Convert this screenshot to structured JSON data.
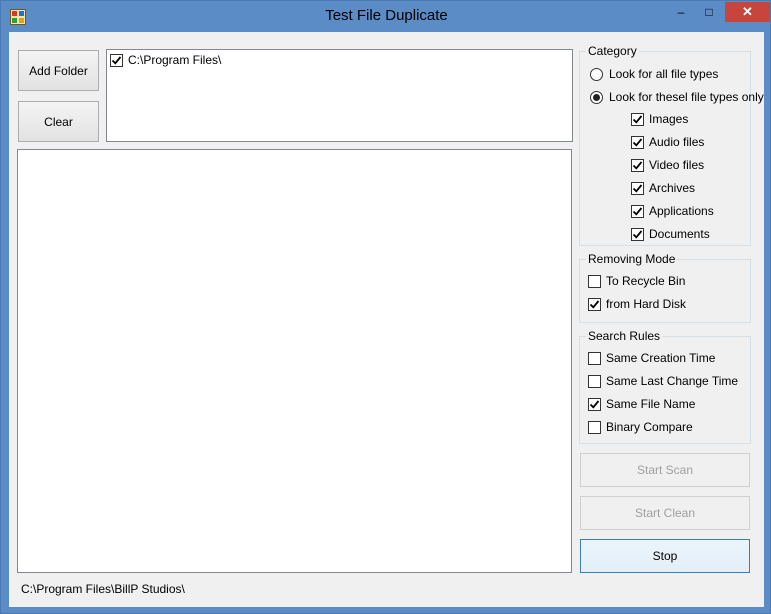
{
  "window": {
    "title": "Test File Duplicate"
  },
  "titlebar_buttons": {
    "minimize": "–",
    "maximize": "□",
    "close": "✕"
  },
  "buttons": {
    "add_folder": "Add Folder",
    "clear": "Clear",
    "start_scan": "Start Scan",
    "start_clean": "Start Clean",
    "stop": "Stop"
  },
  "folders": [
    {
      "path": "C:\\Program Files\\",
      "checked": true
    }
  ],
  "category": {
    "title": "Category",
    "all_types": "Look for all file types",
    "these_types": "Look for thesel file types only",
    "selected": "these_types",
    "types": [
      {
        "label": "Images",
        "checked": true
      },
      {
        "label": "Audio files",
        "checked": true
      },
      {
        "label": "Video files",
        "checked": true
      },
      {
        "label": "Archives",
        "checked": true
      },
      {
        "label": "Applications",
        "checked": true
      },
      {
        "label": "Documents",
        "checked": true
      }
    ]
  },
  "removing_mode": {
    "title": "Removing Mode",
    "options": [
      {
        "label": "To Recycle Bin",
        "checked": false
      },
      {
        "label": "from Hard Disk",
        "checked": true
      }
    ]
  },
  "search_rules": {
    "title": "Search Rules",
    "options": [
      {
        "label": "Same Creation Time",
        "checked": false
      },
      {
        "label": "Same Last Change Time",
        "checked": false
      },
      {
        "label": "Same File Name",
        "checked": true
      },
      {
        "label": "Binary Compare",
        "checked": false
      }
    ]
  },
  "status": "C:\\Program Files\\BillP Studios\\",
  "icons": {
    "app": "app-icon",
    "check": "check-icon"
  }
}
